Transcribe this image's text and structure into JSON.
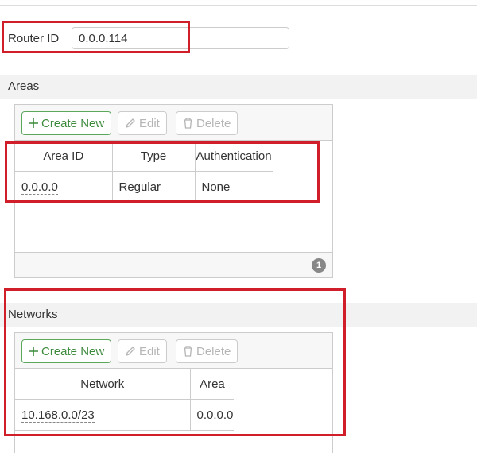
{
  "router": {
    "label": "Router ID",
    "value": "0.0.0.114"
  },
  "areas": {
    "section_title": "Areas",
    "toolbar": {
      "create_label": "Create New",
      "edit_label": "Edit",
      "delete_label": "Delete"
    },
    "columns": [
      "Area ID",
      "Type",
      "Authentication"
    ],
    "rows": [
      {
        "area_id": "0.0.0.0",
        "type": "Regular",
        "authentication": "None"
      }
    ],
    "count": "1"
  },
  "networks": {
    "section_title": "Networks",
    "toolbar": {
      "create_label": "Create New",
      "edit_label": "Edit",
      "delete_label": "Delete"
    },
    "columns": [
      "Network",
      "Area"
    ],
    "rows": [
      {
        "network": "10.168.0.0/23",
        "area": "0.0.0.0"
      }
    ]
  },
  "colors": {
    "highlight": "#d01f2a",
    "create_button": "#3c8a3c",
    "disabled_text": "#b5b5b5"
  },
  "icons": {
    "create": "plus-icon",
    "edit": "pencil-icon",
    "delete": "trash-icon"
  }
}
